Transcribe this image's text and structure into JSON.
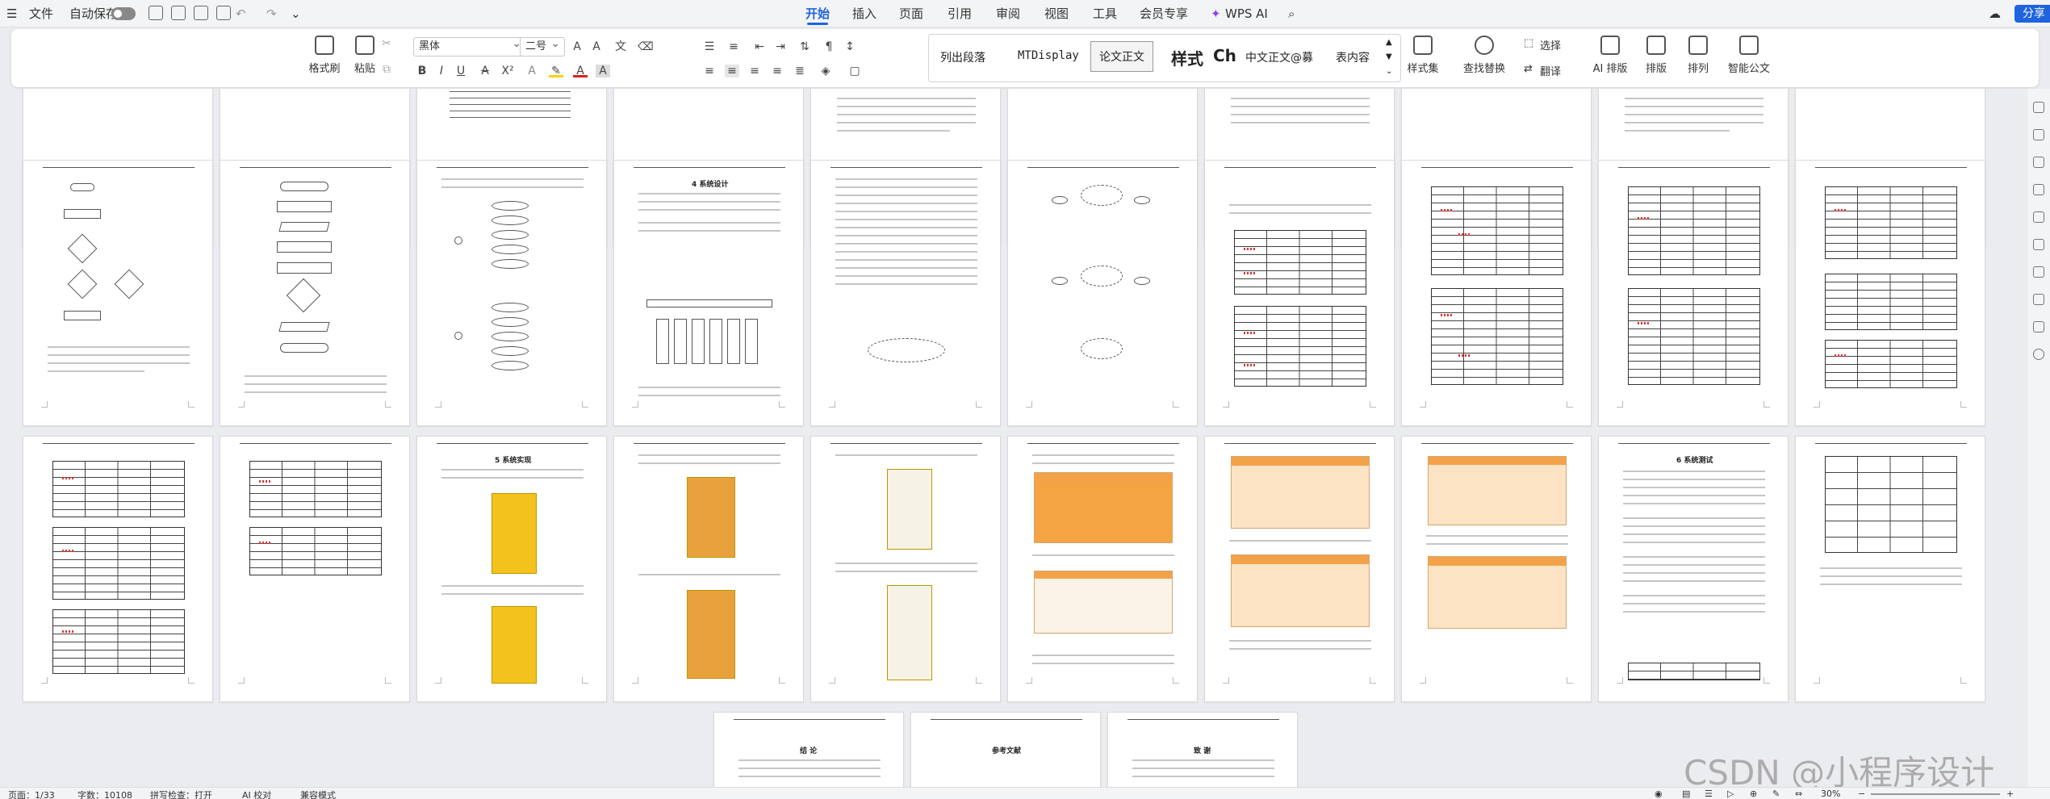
{
  "menubar": {
    "file": "文件",
    "autosave": "自动保存",
    "tabs": [
      "开始",
      "插入",
      "页面",
      "引用",
      "审阅",
      "视图",
      "工具",
      "会员专享"
    ],
    "active_tab": "开始",
    "wps_ai": "WPS AI",
    "share": "分享"
  },
  "ribbon": {
    "format_painter": "格式刷",
    "paste": "粘贴",
    "font_name": "黑体",
    "font_size": "二号",
    "styles": [
      "列出段落",
      "MTDisplay",
      "论文正文",
      "样式",
      "Ch",
      "中文正文@募",
      "表内容"
    ],
    "style_set": "样式集",
    "find_replace": "查找替换",
    "select": "选择",
    "translate": "翻译",
    "ai_layout": "AI 排版",
    "layout": "排版",
    "arrange": "排列",
    "smart_doc": "智能公文"
  },
  "pages": {
    "row4_titles": [
      "结  论",
      "参考文献",
      "致  谢"
    ],
    "row3_page3_title": "5 系统实现",
    "row3_page9_title": "6 系统测试",
    "row2_page4_title": "4 系统设计"
  },
  "statusbar": {
    "page": "页面：1/33",
    "words": "字数：10108",
    "spell": "拼写检查：打开",
    "ai": "AI 校对",
    "compat": "兼容模式",
    "zoom": "30%"
  },
  "watermark": "CSDN @小程序设计"
}
